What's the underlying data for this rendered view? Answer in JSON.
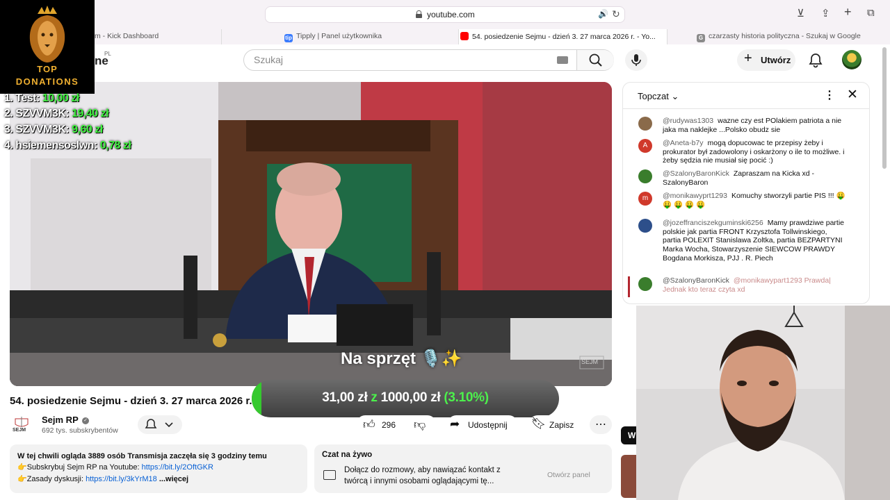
{
  "browser": {
    "url": "youtube.com",
    "tabs": [
      {
        "title": "m - Kick Dashboard",
        "favicon_color": "#53fc18"
      },
      {
        "title": "Tipply | Panel użytkownika",
        "favicon": "tip",
        "favicon_color": "#3a7bfd"
      },
      {
        "title": "54. posiedzenie Sejmu - dzień 3. 27 marca 2026 r. - Yo...",
        "favicon_color": "#ff0000",
        "active": true
      },
      {
        "title": "czarzasty historia polityczna - Szukaj w Google",
        "favicon": "G",
        "favicon_color": "#8a8a8a"
      }
    ]
  },
  "youtube": {
    "logo_partial": "ne",
    "region": "PL",
    "search_placeholder": "Szukaj",
    "create_label": "Utwórz"
  },
  "donations": {
    "title_line1": "TOP",
    "title_line2": "DONATIONS",
    "entries": [
      {
        "rank": "1.",
        "name": "Test:",
        "amount": "10,00 zł"
      },
      {
        "rank": "2.",
        "name": "SZVVM3K:",
        "amount": "19,40 zł"
      },
      {
        "rank": "3.",
        "name": "SZVVM3K:",
        "amount": "9,60 zł"
      },
      {
        "rank": "4.",
        "name": "hsiemensoslwn:",
        "amount": "0,78 zł"
      }
    ]
  },
  "video": {
    "caption": "Na sprzęt 🎙️✨",
    "watermark": "SEJM"
  },
  "goal": {
    "current": "31,00 zł",
    "separator": "z",
    "target": "1000,00 zł",
    "percent_label": "(3.10%)",
    "progress": 0.031
  },
  "info": {
    "title": "54. posiedzenie Sejmu - dzień 3. 27 marca 2026 r.",
    "channel_name": "Sejm RP",
    "subscribers": "692 tys. subskrybentów",
    "channel_logo_text": "SEJM",
    "likes": "296",
    "share_label": "Udostępnij",
    "save_label": "Zapisz"
  },
  "description": {
    "line1_bold": "W tej chwili ogląda 3889 osób  Transmisja zaczęła się 3 godziny temu",
    "line2_prefix": "👉Subskrybuj Sejm RP na Youtube: ",
    "line2_link": "https://bit.ly/2OftGKR",
    "line3_prefix": "👉Zasady dyskusji: ",
    "line3_link": "https://bit.ly/3kYrM18",
    "more": "...więcej"
  },
  "chat_promo": {
    "title": "Czat na żywo",
    "text": "Dołącz do rozmowy, aby nawiązać kontakt z twórcą i innymi osobami oglądającymi tę...",
    "button": "Otwórz panel"
  },
  "live_chat": {
    "mode": "Topczat",
    "messages": [
      {
        "author": "@rudywas1303",
        "text": "wazne czy est POlakiem patriota a nie jaka ma naklejke ...Polsko obudz sie",
        "avatar_color": "#8a6a4a",
        "avatar_letter": ""
      },
      {
        "author": "@Aneta-b7y",
        "text": "mogą dopucowac te przepisy żeby i prokurator był zadowolony i oskarżony o ile to możliwe. i żeby sędzia nie musiał się pocić :)",
        "avatar_color": "#d0392b",
        "avatar_letter": "A"
      },
      {
        "author": "@SzalonyBaronKick",
        "text": "Zapraszam na Kicka xd - SzalonyBaron",
        "avatar_color": "#3a7d2c",
        "avatar_letter": ""
      },
      {
        "author": "@monikawyprt1293",
        "text": "Komuchy stworzyli partie PIS !!! 🤑 🤑 🤑 🤑 🤑",
        "avatar_color": "#d0392b",
        "avatar_letter": "m"
      },
      {
        "author": "@jozeffranciszekguminski6256",
        "text": "Mamy prawdziwe partie polskie jak partia FRONT Krzysztofa Tollwinskiego, partia POLEXIT Stanislawa Zoltka, partia BEZPARTYNI Marka Wocha, Stowarzyszenie SIEWCOW PRAWDY Bogdana Morkisza, PJJ . R. Piech",
        "avatar_color": "#2d4f8a",
        "avatar_letter": ""
      },
      {
        "author": "@SzalonyBaronKick",
        "text": "@monikawypart1293 Prawda| Jednak kto teraz czyta xd",
        "avatar_color": "#3a7d2c",
        "avatar_letter": "",
        "highlight": true
      }
    ]
  }
}
